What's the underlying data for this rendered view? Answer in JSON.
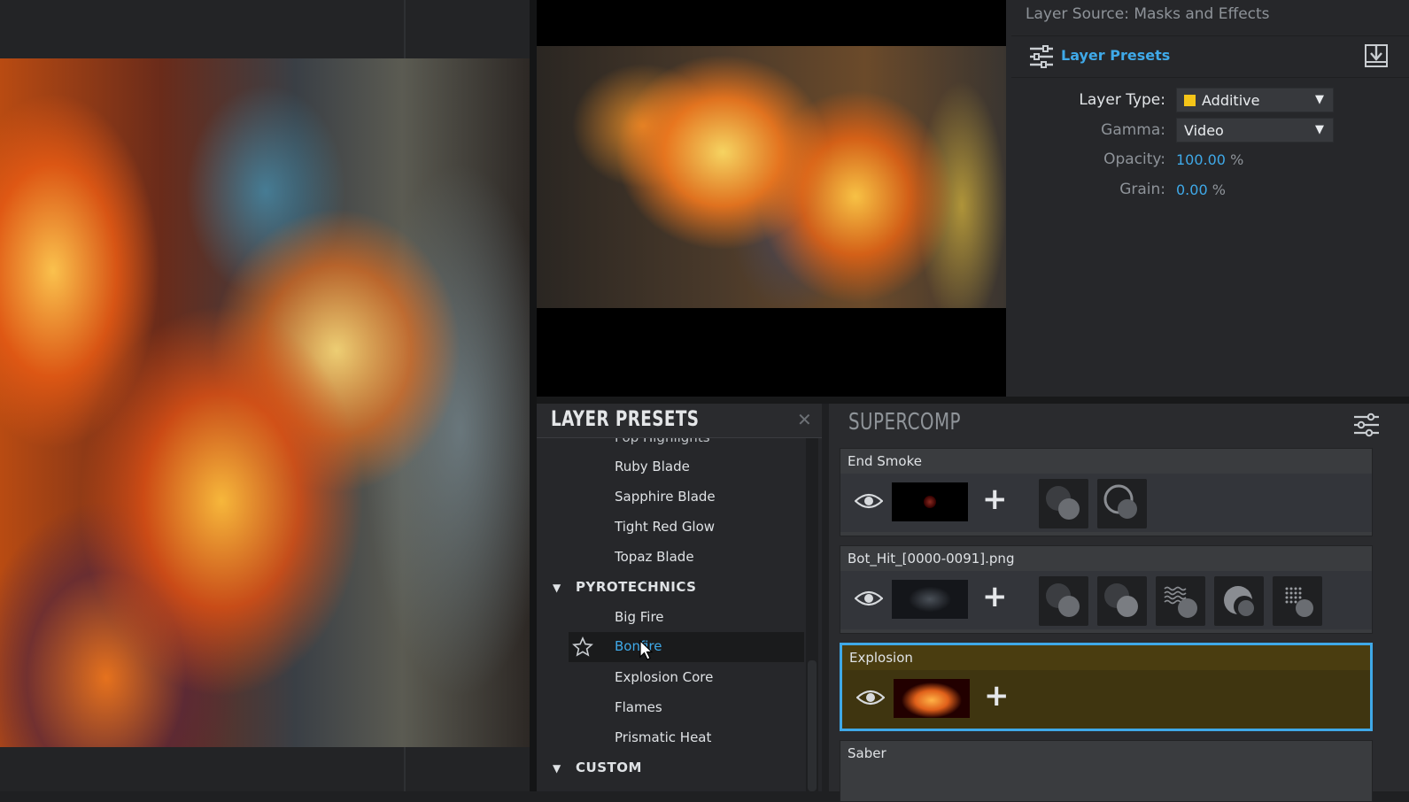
{
  "properties": {
    "title": "Layer Source: Masks and Effects",
    "presets_label": "Layer Presets",
    "layer_type_label": "Layer Type:",
    "layer_type_value": "Additive",
    "layer_type_swatch": "#f5c518",
    "gamma_label": "Gamma:",
    "gamma_value": "Video",
    "opacity_label": "Opacity:",
    "opacity_value": "100.00",
    "opacity_unit": "%",
    "grain_label": "Grain:",
    "grain_value": "0.00",
    "grain_unit": "%"
  },
  "layer_presets": {
    "title": "LAYER PRESETS",
    "close": "✕",
    "partial_item": "Pop Highlights",
    "items_top": [
      "Ruby Blade",
      "Sapphire Blade",
      "Tight Red Glow",
      "Topaz Blade"
    ],
    "category_1": "PYROTECHNICS",
    "pyro_items": [
      "Big Fire",
      "Bonfire",
      "Explosion Core",
      "Flames",
      "Prismatic Heat"
    ],
    "selected_item": "Bonfire",
    "category_2": "CUSTOM"
  },
  "supercomp": {
    "title": "SUPERCOMP",
    "layers": [
      {
        "name": "End Smoke"
      },
      {
        "name": "Bot_Hit_[0000-0091].png"
      },
      {
        "name": "Explosion"
      },
      {
        "name": "Saber"
      }
    ],
    "plus": "+"
  },
  "colors": {
    "accent": "#3fa9e8",
    "active_layer_bg": "#4a3d10"
  }
}
